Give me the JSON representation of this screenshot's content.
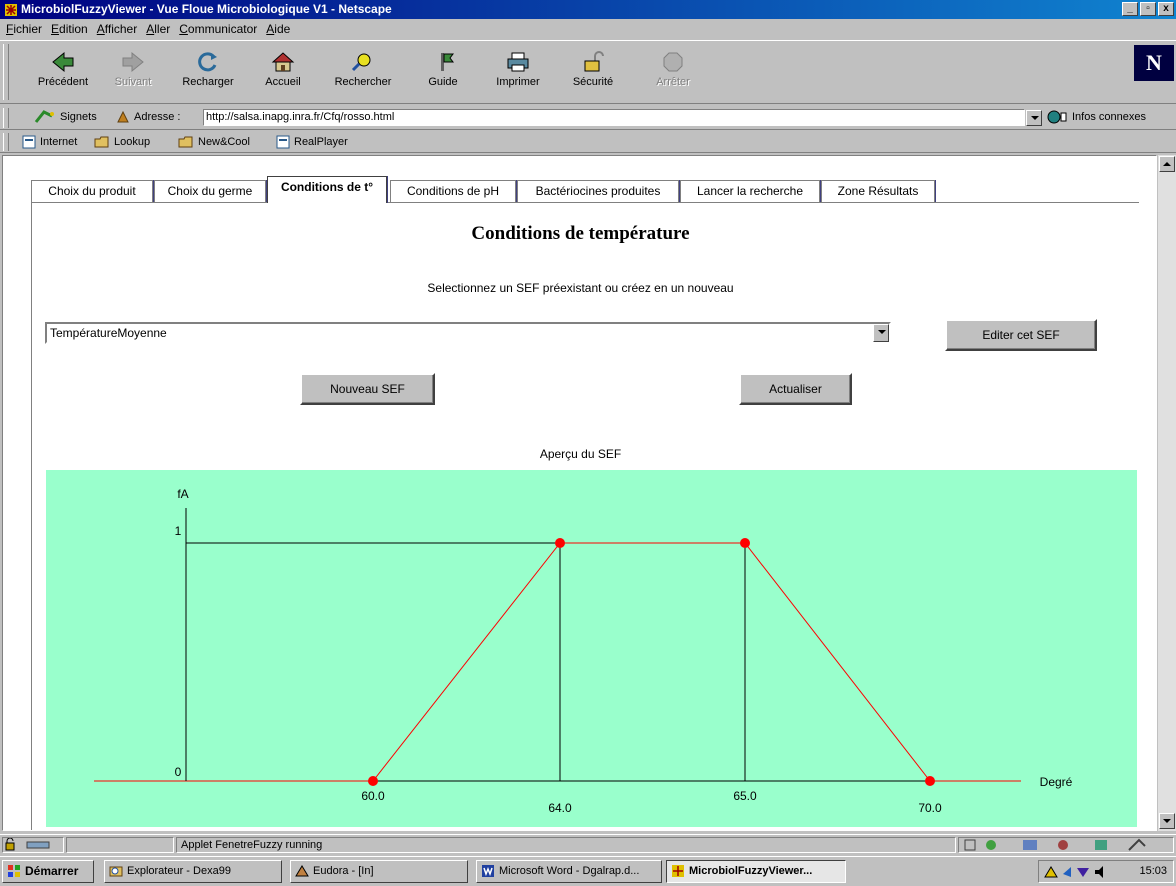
{
  "window": {
    "title": "MicrobiolFuzzyViewer - Vue Floue Microbiologique V1 - Netscape",
    "controls": [
      "_",
      "▫",
      "x"
    ]
  },
  "menu": [
    "Fichier",
    "Edition",
    "Afficher",
    "Aller",
    "Communicator",
    "Aide"
  ],
  "toolbar": {
    "back": "Précédent",
    "forward": "Suivant",
    "reload": "Recharger",
    "home": "Accueil",
    "search": "Rechercher",
    "guide": "Guide",
    "print": "Imprimer",
    "security": "Sécurité",
    "stop": "Arrêter"
  },
  "location": {
    "bookmarks": "Signets",
    "label": "Adresse :",
    "url": "http://salsa.inapg.inra.fr/Cfq/rosso.html",
    "related": "Infos connexes"
  },
  "links": [
    "Internet",
    "Lookup",
    "New&Cool",
    "RealPlayer"
  ],
  "tabs": [
    {
      "label": "Choix du produit"
    },
    {
      "label": "Choix du germe"
    },
    {
      "label": "Conditions de t°"
    },
    {
      "label": "Conditions de pH"
    },
    {
      "label": "Bactériocines produites"
    },
    {
      "label": "Lancer la recherche"
    },
    {
      "label": "Zone Résultats"
    }
  ],
  "page": {
    "heading": "Conditions de température",
    "subtitle": "Selectionnez un SEF préexistant ou créez en un nouveau",
    "select_value": "TempératureMoyenne",
    "edit_button": "Editer cet SEF",
    "new_button": "Nouveau SEF",
    "refresh_button": "Actualiser",
    "preview_label": "Aperçu du SEF"
  },
  "chart_data": {
    "type": "line",
    "ylabel": "fA",
    "xlabel": "Degré",
    "y_ticks": [
      "0",
      "1"
    ],
    "series": [
      {
        "points": [
          [
            60.0,
            0
          ],
          [
            64.0,
            1
          ],
          [
            65.0,
            1
          ],
          [
            70.0,
            0
          ]
        ]
      }
    ],
    "x_tick_labels": [
      "60.0",
      "64.0",
      "65.0",
      "70.0"
    ],
    "colors": {
      "background": "#99ffcc",
      "line": "#ff0000",
      "points": "#ff0000",
      "axes": "#000000"
    }
  },
  "status": {
    "text": "Applet FenetreFuzzy running"
  },
  "taskbar": {
    "start": "Démarrer",
    "tasks": [
      "Explorateur - Dexa99",
      "Eudora - [In]",
      "Microsoft Word - Dgalrap.d...",
      "MicrobiolFuzzyViewer..."
    ],
    "clock": "15:03"
  }
}
